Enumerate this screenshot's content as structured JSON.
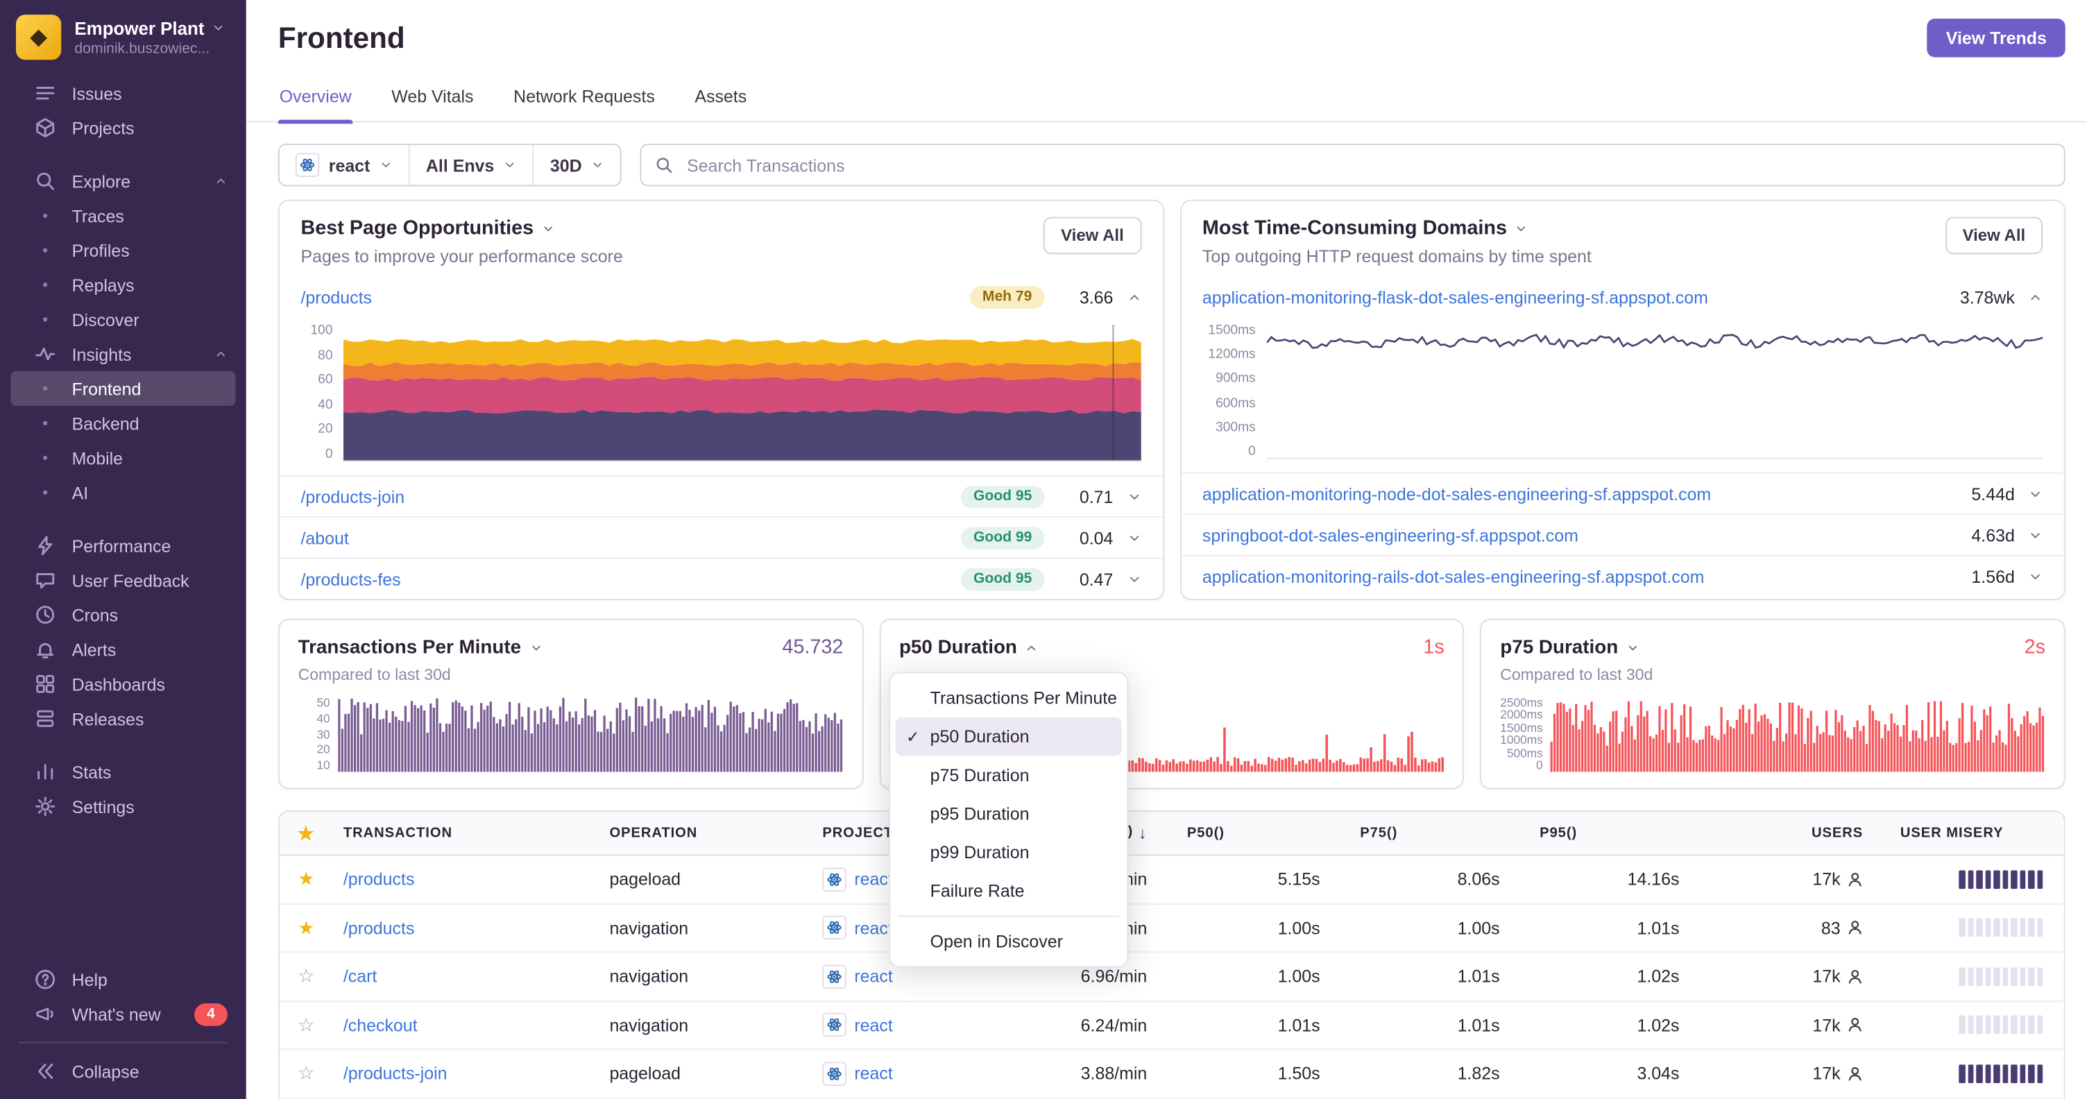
{
  "colors": {
    "accent": "#6c5fc7",
    "link": "#3d74db",
    "danger": "#f55459",
    "tpm_purple": "#7a5c93"
  },
  "org": {
    "name": "Empower Plant",
    "subtitle": "dominik.buszowiec..."
  },
  "sidebar": {
    "items": [
      {
        "type": "link",
        "icon": "issues",
        "label": "Issues"
      },
      {
        "type": "link",
        "icon": "projects",
        "label": "Projects"
      },
      {
        "type": "space"
      },
      {
        "type": "section",
        "icon": "search",
        "label": "Explore"
      },
      {
        "type": "sub",
        "label": "Traces"
      },
      {
        "type": "sub",
        "label": "Profiles"
      },
      {
        "type": "sub",
        "label": "Replays"
      },
      {
        "type": "sub",
        "label": "Discover"
      },
      {
        "type": "section",
        "icon": "insights",
        "label": "Insights"
      },
      {
        "type": "sub",
        "label": "Frontend",
        "selected": true
      },
      {
        "type": "sub",
        "label": "Backend"
      },
      {
        "type": "sub",
        "label": "Mobile"
      },
      {
        "type": "sub",
        "label": "AI"
      },
      {
        "type": "space"
      },
      {
        "type": "link",
        "icon": "performance",
        "label": "Performance"
      },
      {
        "type": "link",
        "icon": "feedback",
        "label": "User Feedback"
      },
      {
        "type": "link",
        "icon": "crons",
        "label": "Crons"
      },
      {
        "type": "link",
        "icon": "alerts",
        "label": "Alerts"
      },
      {
        "type": "link",
        "icon": "dashboards",
        "label": "Dashboards"
      },
      {
        "type": "link",
        "icon": "releases",
        "label": "Releases"
      },
      {
        "type": "space"
      },
      {
        "type": "link",
        "icon": "stats",
        "label": "Stats"
      },
      {
        "type": "link",
        "icon": "settings",
        "label": "Settings"
      }
    ],
    "footer": [
      {
        "type": "link",
        "icon": "help",
        "label": "Help"
      },
      {
        "type": "link",
        "icon": "broadcast",
        "label": "What's new",
        "badge": "4"
      },
      {
        "type": "divider"
      },
      {
        "type": "link",
        "icon": "collapse",
        "label": "Collapse"
      }
    ]
  },
  "header": {
    "title": "Frontend",
    "action": "View Trends"
  },
  "tabs": [
    {
      "label": "Overview",
      "active": true
    },
    {
      "label": "Web Vitals"
    },
    {
      "label": "Network Requests"
    },
    {
      "label": "Assets"
    }
  ],
  "filters": {
    "project": "react",
    "environment": "All Envs",
    "period": "30D",
    "search_placeholder": "Search Transactions"
  },
  "opportunities": {
    "title": "Best Page Opportunities",
    "subtitle": "Pages to improve your performance score",
    "view_all": "View All",
    "expanded": {
      "page": "/products",
      "badge": "Meh 79",
      "score": "3.66"
    },
    "rows": [
      {
        "page": "/products-join",
        "badge": "Good 95",
        "score": "0.71"
      },
      {
        "page": "/about",
        "badge": "Good 99",
        "score": "0.04"
      },
      {
        "page": "/products-fes",
        "badge": "Good 95",
        "score": "0.47"
      }
    ],
    "chart": {
      "kind": "stack",
      "ymax": 100,
      "seed": 11,
      "marker_x": 0.965,
      "y_ticks": [
        "100",
        "80",
        "60",
        "40",
        "20",
        "0"
      ],
      "bands": [
        {
          "color": "#4e4672",
          "top": 36
        },
        {
          "color": "#d34d78",
          "top": 60
        },
        {
          "color": "#ef7e33",
          "top": 71
        },
        {
          "color": "#f3b71b",
          "top": 88
        }
      ]
    }
  },
  "domains": {
    "title": "Most Time-Consuming Domains",
    "subtitle": "Top outgoing HTTP request domains by time spent",
    "view_all": "View All",
    "expanded": {
      "domain": "application-monitoring-flask-dot-sales-engineering-sf.appspot.com",
      "value": "3.78wk"
    },
    "rows": [
      {
        "domain": "application-monitoring-node-dot-sales-engineering-sf.appspot.com",
        "value": "5.44d"
      },
      {
        "domain": "springboot-dot-sales-engineering-sf.appspot.com",
        "value": "4.63d"
      },
      {
        "domain": "application-monitoring-rails-dot-sales-engineering-sf.appspot.com",
        "value": "1.56d"
      }
    ],
    "chart": {
      "kind": "line",
      "ymax": 1600,
      "base": 1400,
      "amp": 90,
      "seed": 5,
      "color": "#444674",
      "y_ticks": [
        "1500ms",
        "1200ms",
        "900ms",
        "600ms",
        "300ms",
        "0"
      ]
    }
  },
  "cards": [
    {
      "title": "Transactions Per Minute",
      "value": "45.732",
      "value_color": "#6d5a8e",
      "subtitle": "Compared to last 30d",
      "y_ticks": [
        "50",
        "40",
        "30",
        "20",
        "10"
      ],
      "chart": {
        "kind": "bars",
        "seed": 3,
        "count": 160,
        "min": 0.5,
        "max": 1.0,
        "color": "#7a5c93"
      }
    },
    {
      "title": "p50 Duration",
      "value": "1s",
      "value_color": "#f55459",
      "open": true,
      "chart": {
        "kind": "bars",
        "seed": 8,
        "count": 160,
        "min": 0.08,
        "max": 0.2,
        "spike": 0.05,
        "spike_max": 0.55,
        "color": "#f55459"
      }
    },
    {
      "title": "p75 Duration",
      "value": "2s",
      "value_color": "#f55459",
      "subtitle": "Compared to last 30d",
      "y_ticks": [
        "2500ms",
        "2000ms",
        "1500ms",
        "1000ms",
        "500ms",
        "0"
      ],
      "chart": {
        "kind": "bars",
        "seed": 4,
        "count": 160,
        "min": 0.35,
        "max": 0.95,
        "color": "#f55459"
      }
    }
  ],
  "dropdown": {
    "items": [
      {
        "label": "Transactions Per Minute"
      },
      {
        "label": "p50 Duration",
        "selected": true
      },
      {
        "label": "p75 Duration"
      },
      {
        "label": "p95 Duration"
      },
      {
        "label": "p99 Duration"
      },
      {
        "label": "Failure Rate"
      }
    ],
    "footer": "Open in Discover"
  },
  "table": {
    "columns": [
      "TRANSACTION",
      "OPERATION",
      "PROJECT",
      "TPM()",
      "P50()",
      "P75()",
      "P95()",
      "USERS",
      "USER MISERY"
    ],
    "sort_column": "TPM()",
    "rows": [
      {
        "starred": true,
        "transaction": "/products",
        "operation": "pageload",
        "project": "react",
        "tpm": "/min",
        "p50": "5.15s",
        "p75": "8.06s",
        "p95": "14.16s",
        "users": "17k",
        "misery": "high"
      },
      {
        "starred": true,
        "transaction": "/products",
        "operation": "navigation",
        "project": "react",
        "tpm": "/min",
        "p50": "1.00s",
        "p75": "1.00s",
        "p95": "1.01s",
        "users": "83",
        "misery": "low"
      },
      {
        "starred": false,
        "transaction": "/cart",
        "operation": "navigation",
        "project": "react",
        "tpm": "6.96/min",
        "p50": "1.00s",
        "p75": "1.01s",
        "p95": "1.02s",
        "users": "17k",
        "misery": "low"
      },
      {
        "starred": false,
        "transaction": "/checkout",
        "operation": "navigation",
        "project": "react",
        "tpm": "6.24/min",
        "p50": "1.01s",
        "p75": "1.01s",
        "p95": "1.02s",
        "users": "17k",
        "misery": "low"
      },
      {
        "starred": false,
        "transaction": "/products-join",
        "operation": "pageload",
        "project": "react",
        "tpm": "3.88/min",
        "p50": "1.50s",
        "p75": "1.82s",
        "p95": "3.04s",
        "users": "17k",
        "misery": "high"
      }
    ]
  }
}
